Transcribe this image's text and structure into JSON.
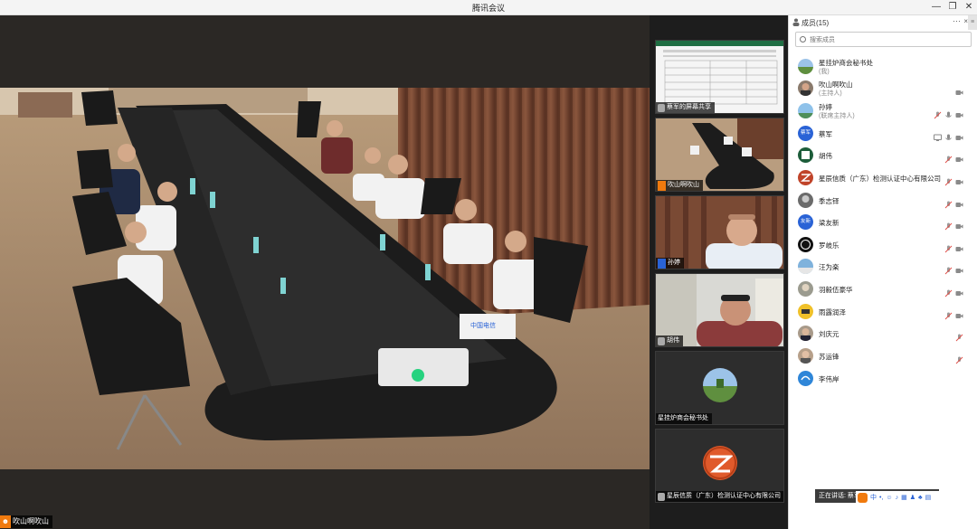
{
  "window": {
    "title": "腾讯会议"
  },
  "main_video": {
    "speaker_name": "吹山啊吹山"
  },
  "thumbnails": [
    {
      "name": "蔡军的屏幕共享"
    },
    {
      "name": "吹山啊吹山"
    },
    {
      "name": "孙婷"
    },
    {
      "name": "胡伟"
    },
    {
      "name": "星挂炉商会秘书处"
    },
    {
      "name": "星辰信质（广东）检测认证中心有限公司"
    }
  ],
  "panel": {
    "title": "成员(15)",
    "more": "···",
    "close": "×",
    "search_placeholder": "搜索成员"
  },
  "members": [
    {
      "name": "星挂炉商会秘书处",
      "role": "(我)",
      "avatar": "landscape",
      "icons": []
    },
    {
      "name": "吹山啊吹山",
      "role": "(主持人)",
      "avatar": "photo-man",
      "icons": [
        "camera"
      ]
    },
    {
      "name": "孙婷",
      "role": "(联席主持人)",
      "avatar": "sky",
      "icons": [
        "mic-muted",
        "mic",
        "camera"
      ]
    },
    {
      "name": "蔡军",
      "role": "",
      "avatar": "text-blue",
      "avatar_text": "蔡军",
      "icons": [
        "screen",
        "mic",
        "camera"
      ]
    },
    {
      "name": "胡伟",
      "role": "",
      "avatar": "green-logo",
      "icons": [
        "mic-muted",
        "camera"
      ]
    },
    {
      "name": "星辰信质（广东）检测认证中心有限公司",
      "role": "",
      "avatar": "red-logo",
      "icons": [
        "mic-muted",
        "camera"
      ]
    },
    {
      "name": "季志铎",
      "role": "",
      "avatar": "photo-grey",
      "icons": [
        "mic-muted",
        "camera"
      ]
    },
    {
      "name": "梁友新",
      "role": "",
      "avatar": "text-blue",
      "avatar_text": "友新",
      "icons": [
        "mic-muted",
        "camera"
      ]
    },
    {
      "name": "罗岐乐",
      "role": "",
      "avatar": "dark-logo",
      "icons": [
        "mic-muted",
        "camera"
      ]
    },
    {
      "name": "汪为楽",
      "role": "",
      "avatar": "sky2",
      "icons": [
        "mic-muted",
        "camera"
      ]
    },
    {
      "name": "羽毅伍豪华",
      "role": "",
      "avatar": "photo-grey2",
      "icons": [
        "mic-muted",
        "camera"
      ]
    },
    {
      "name": "雨露润泽",
      "role": "",
      "avatar": "yellow",
      "icons": [
        "mic-muted",
        "camera"
      ]
    },
    {
      "name": "刘庆元",
      "role": "",
      "avatar": "photo-man2",
      "icons": [
        "mic-muted"
      ]
    },
    {
      "name": "苏运锋",
      "role": "",
      "avatar": "photo-man3",
      "icons": [
        "mic-muted"
      ]
    },
    {
      "name": "李伟岸",
      "role": "",
      "avatar": "blue-bird",
      "icons": []
    }
  ],
  "speaking_bar": {
    "text": "正在讲话: 蔡军"
  },
  "ime": {
    "lang": "中"
  },
  "colors": {
    "accent": "#2a63d6",
    "brand_orange": "#f07a0e",
    "muted_red": "#e0504a"
  }
}
